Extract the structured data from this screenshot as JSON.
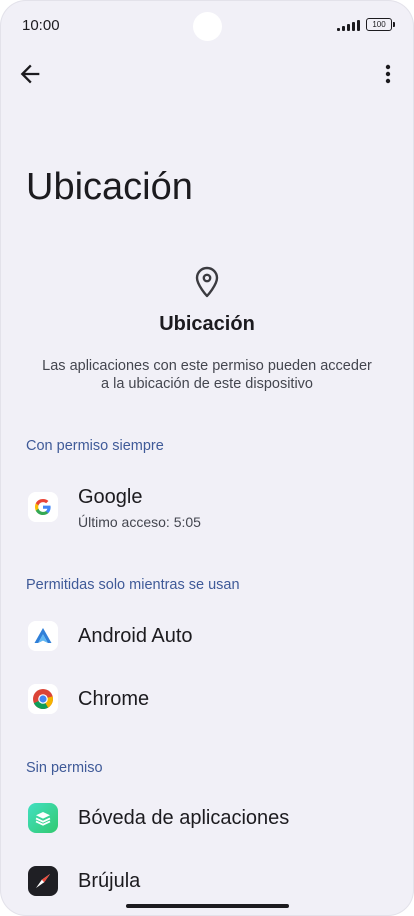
{
  "status": {
    "time": "10:00",
    "battery": "100"
  },
  "toolbar": {
    "back_icon": "arrow-back-icon",
    "menu_icon": "more-vert-icon"
  },
  "page": {
    "title": "Ubicación"
  },
  "hero": {
    "icon": "location-pin-icon",
    "title": "Ubicación",
    "description": "Las aplicaciones con este permiso pueden acceder a la ubicación de este dispositivo"
  },
  "sections": {
    "always": {
      "header": "Con permiso siempre",
      "apps": [
        {
          "name": "Google",
          "subtitle": "Último acceso: 5:05",
          "icon": "google-icon"
        }
      ]
    },
    "while_in_use": {
      "header": "Permitidas solo mientras se usan",
      "apps": [
        {
          "name": "Android Auto",
          "icon": "android-auto-icon"
        },
        {
          "name": "Chrome",
          "icon": "chrome-icon"
        }
      ]
    },
    "denied": {
      "header": "Sin permiso",
      "apps": [
        {
          "name": "Bóveda de aplicaciones",
          "icon": "app-vault-icon"
        },
        {
          "name": "Brújula",
          "icon": "compass-icon"
        }
      ]
    }
  },
  "colors": {
    "background": "#f1f0f7",
    "section_header": "#3f5a98",
    "text_primary": "#1c1b1f",
    "text_secondary": "#44464f"
  }
}
